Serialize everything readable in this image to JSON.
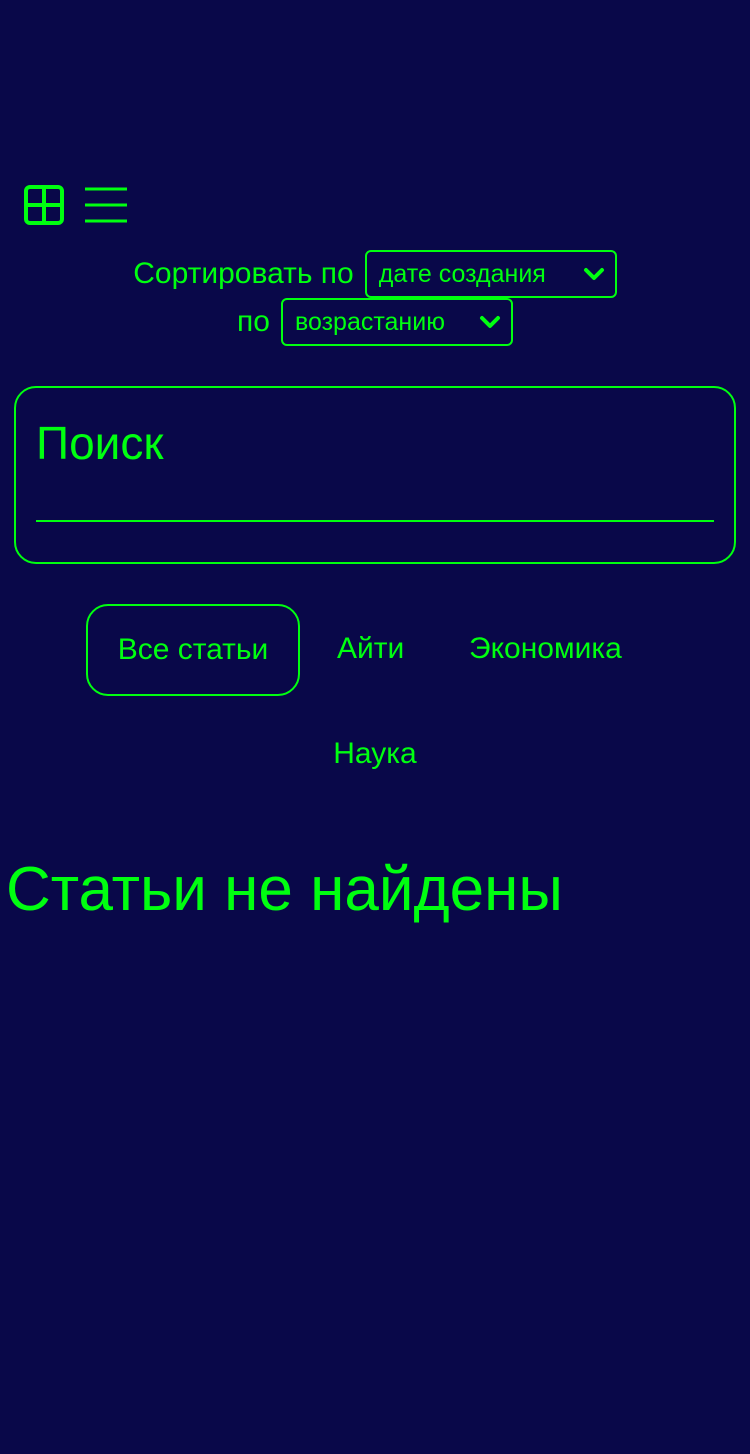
{
  "theme": {
    "background": "#090849",
    "accent": "#00ff10"
  },
  "view_toggle": {
    "grid_icon": "grid-icon",
    "list_icon": "list-icon"
  },
  "sort": {
    "label": "Сортировать по",
    "field_value": "дате создания",
    "order_label": "по",
    "order_value": "возрастанию",
    "dropdown_icon": "chevron-down-icon"
  },
  "search": {
    "placeholder": "Поиск",
    "value": ""
  },
  "tabs": [
    {
      "label": "Все статьи",
      "active": true
    },
    {
      "label": "Айти",
      "active": false
    },
    {
      "label": "Экономика",
      "active": false
    },
    {
      "label": "Наука",
      "active": false
    }
  ],
  "empty_message": "Статьи не найдены"
}
